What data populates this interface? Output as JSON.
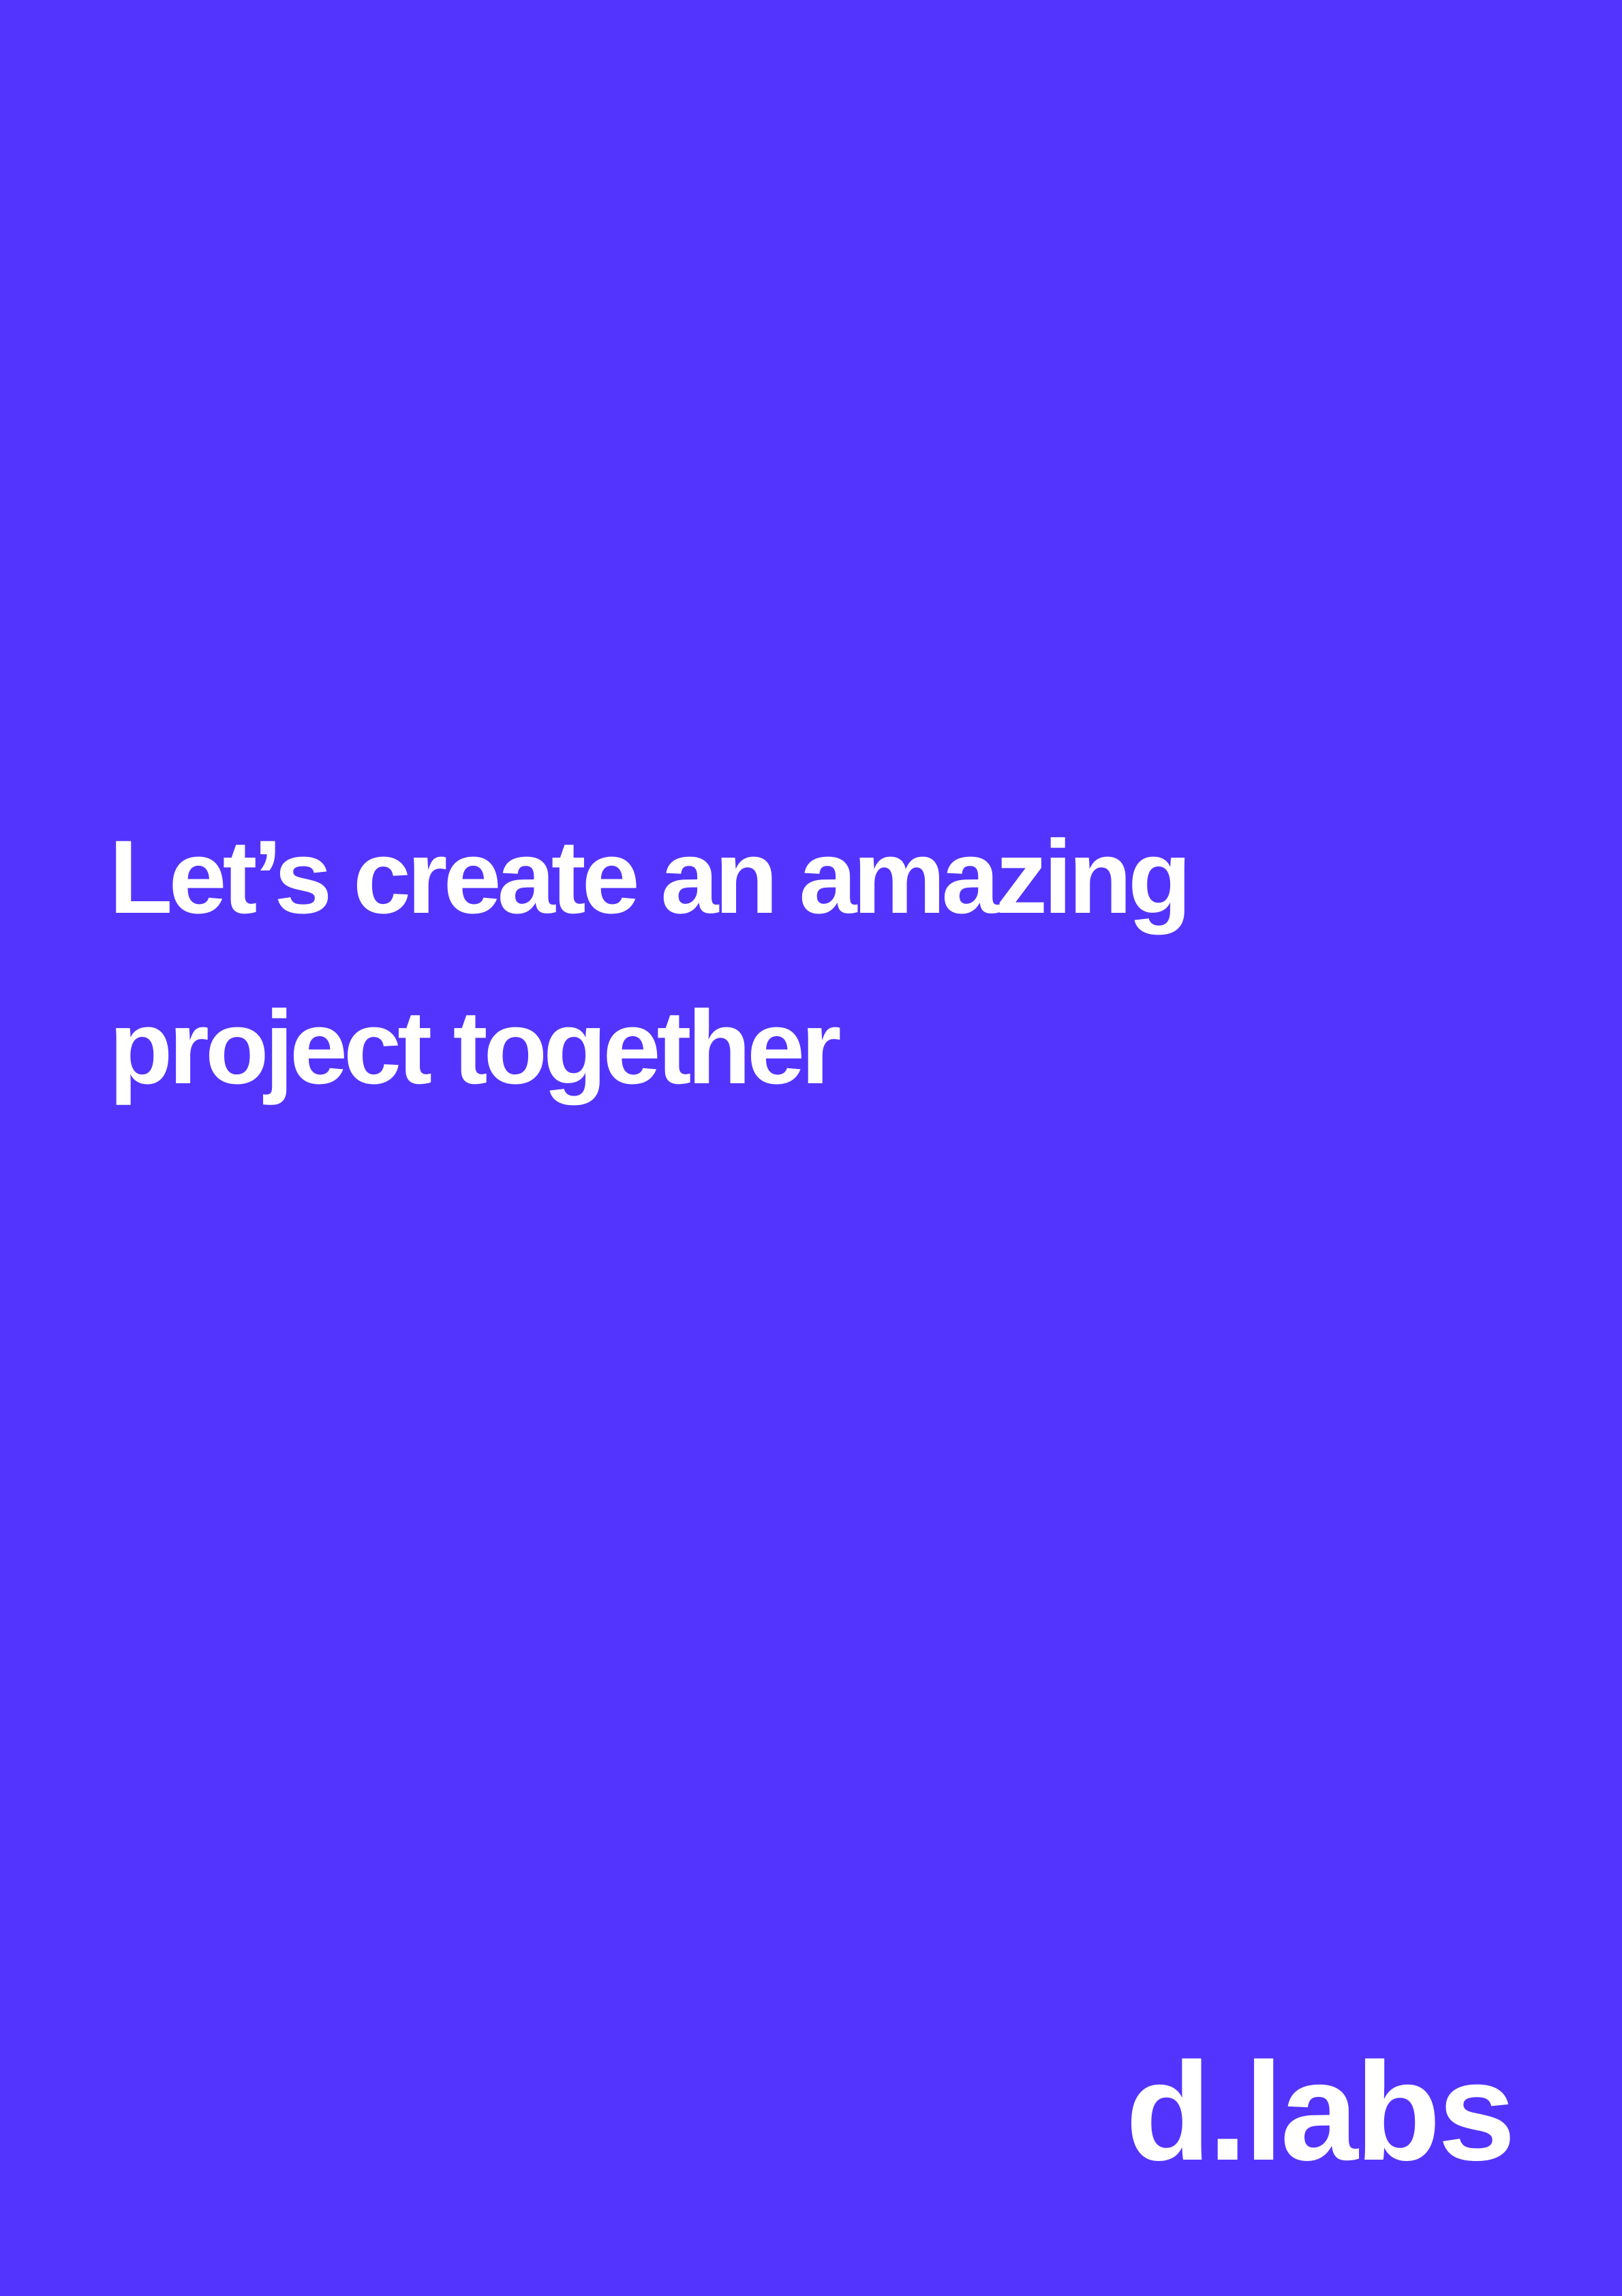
{
  "background_color": "#5334FF",
  "text_color": "#FFFFFF",
  "headline": {
    "line1": "Let’s create an amazing",
    "line2": "project together"
  },
  "brand": {
    "logo_text": "d.labs"
  }
}
